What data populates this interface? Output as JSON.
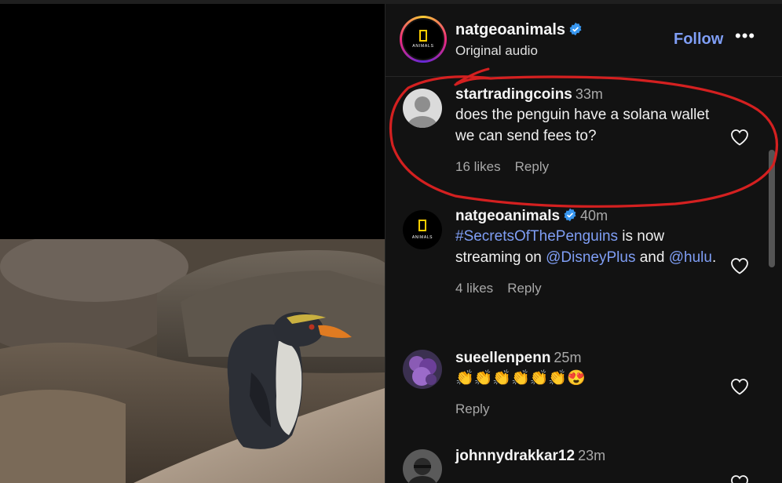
{
  "header": {
    "account_name": "natgeoanimals",
    "audio_label": "Original audio",
    "follow_label": "Follow",
    "more_label": "•••",
    "logo_text": "ANIMALS"
  },
  "comments": [
    {
      "user": "startradingcoins",
      "time": "33m",
      "text": "does the penguin have a solana wallet we can send fees to?",
      "likes": "16 likes",
      "reply": "Reply"
    },
    {
      "user": "natgeoanimals",
      "time": "40m",
      "hashtag": "#SecretsOfThePenguins",
      "text_mid": " is now streaming on ",
      "mention1": "@DisneyPlus",
      "text_and": " and ",
      "mention2": "@hulu",
      "text_end": ".",
      "likes": "4 likes",
      "reply": "Reply"
    },
    {
      "user": "sueellenpenn",
      "time": "25m",
      "text": "👏👏👏👏👏👏😍",
      "reply": "Reply"
    },
    {
      "user": "johnnydrakkar12",
      "time": "23m"
    }
  ],
  "colors": {
    "link": "#7f9ef5",
    "annotation": "#d42020",
    "background": "#121212"
  },
  "icons": [
    "verified-badge-icon",
    "heart-icon",
    "more-options-icon",
    "default-avatar-icon"
  ]
}
